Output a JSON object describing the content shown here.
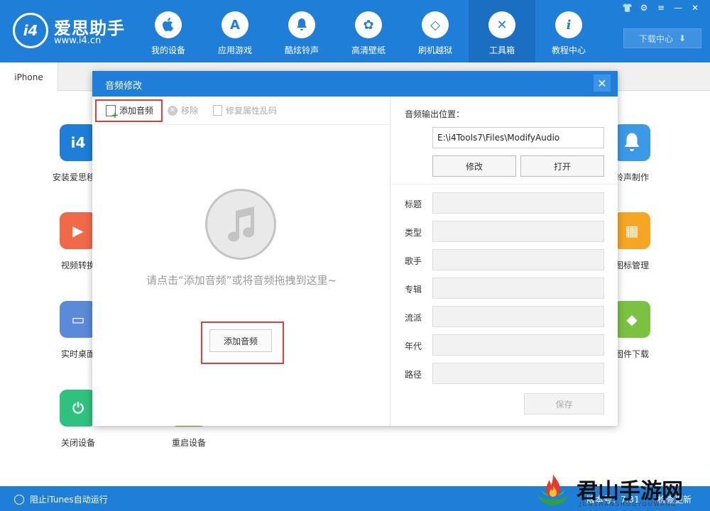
{
  "app": {
    "brand_name": "爱思助手",
    "brand_url": "www.i4.cn",
    "logo_text": "i4"
  },
  "nav": [
    {
      "label": "我的设备",
      "icon": "apple-icon",
      "glyph": ""
    },
    {
      "label": "应用游戏",
      "icon": "app-store-icon",
      "glyph": "A"
    },
    {
      "label": "酷炫铃声",
      "icon": "bell-icon",
      "glyph": "♪"
    },
    {
      "label": "高清壁纸",
      "icon": "flower-icon",
      "glyph": "✿"
    },
    {
      "label": "刷机越狱",
      "icon": "box-icon",
      "glyph": "◇"
    },
    {
      "label": "工具箱",
      "icon": "tools-icon",
      "glyph": "✕"
    },
    {
      "label": "教程中心",
      "icon": "info-icon",
      "glyph": "i"
    }
  ],
  "download_center": "下载中心",
  "device_tab": "iPhone",
  "tools": [
    {
      "label": "安装爱思移动",
      "color": "#1e7ed8",
      "glyph": "i4"
    },
    {
      "label": "铃声制作",
      "color": "#3a9ae8",
      "glyph": "🔔"
    },
    {
      "label": "视频转换",
      "color": "#f06a4a",
      "glyph": "▶"
    },
    {
      "label": "图标管理",
      "color": "#f5a623",
      "glyph": "▦"
    },
    {
      "label": "实时桌面",
      "color": "#5b8ad8",
      "glyph": "▭"
    },
    {
      "label": "固件下载",
      "color": "#7cc242",
      "glyph": "◆"
    },
    {
      "label": "关闭设备",
      "color": "#2ec27e",
      "glyph": "⏻"
    },
    {
      "label": "重启设备",
      "color": "#6aa83c",
      "glyph": ""
    }
  ],
  "footer": {
    "itunes_block": "阻止iTunes自动运行",
    "version": "版本号：7.31",
    "check_update": "检查更新"
  },
  "watermark": {
    "text": "君山手游网",
    "sub": "JUNSHANSHOUYOUWANG"
  },
  "dialog": {
    "title": "音频修改",
    "toolbar": {
      "add": "添加音频",
      "remove": "移除",
      "repair": "修复属性乱码"
    },
    "hint": "请点击“添加音频”或将音频拖拽到这里~",
    "center_add": "添加音频",
    "output_label": "音频输出位置：",
    "output_path": "E:\\i4Tools7\\Files\\ModifyAudio",
    "modify_btn": "修改",
    "open_btn": "打开",
    "fields": [
      {
        "label": "标题",
        "value": ""
      },
      {
        "label": "类型",
        "value": ""
      },
      {
        "label": "歌手",
        "value": ""
      },
      {
        "label": "专辑",
        "value": ""
      },
      {
        "label": "流派",
        "value": ""
      },
      {
        "label": "年代",
        "value": ""
      },
      {
        "label": "路径",
        "value": ""
      }
    ],
    "save_btn": "保存"
  }
}
